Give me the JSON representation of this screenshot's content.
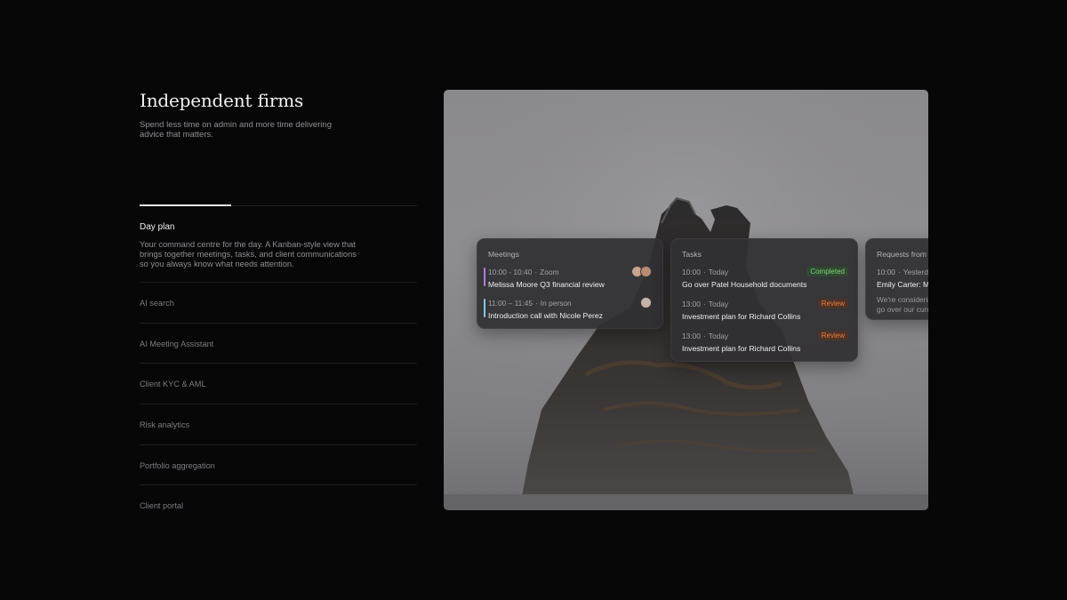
{
  "hero": {
    "headline": "Independent firms",
    "subheadline": "Spend less time on admin and more time delivering advice that matters."
  },
  "features": {
    "progress": 0.33,
    "active": {
      "title": "Day plan",
      "description": "Your command centre for the day. A Kanban-style view that brings together meetings, tasks, and client communications so you always know what needs attention."
    },
    "items": [
      {
        "label": "AI search"
      },
      {
        "label": "AI Meeting Assistant"
      },
      {
        "label": "Client KYC & AML"
      },
      {
        "label": "Risk analytics"
      },
      {
        "label": "Portfolio aggregation"
      },
      {
        "label": "Client portal"
      }
    ]
  },
  "board": {
    "meetings": {
      "title": "Meetings",
      "items": [
        {
          "time": "10:00 - 10:40",
          "sep": "·",
          "where": "Zoom",
          "name": "Melissa Moore Q3 financial review",
          "accent": "#b27be0"
        },
        {
          "time": "11:00 – 11:45",
          "sep": "·",
          "where": "In person",
          "name": "Introduction call with Nicole Perez",
          "accent": "#7fc8e6"
        }
      ]
    },
    "tasks": {
      "title": "Tasks",
      "items": [
        {
          "time": "10:00",
          "sep": "·",
          "when": "Today",
          "name": "Go over Patel Household documents",
          "status": "Completed"
        },
        {
          "time": "13:00",
          "sep": "·",
          "when": "Today",
          "name": "Investment plan for Richard Collins",
          "status": "Review"
        },
        {
          "time": "13:00",
          "sep": "·",
          "when": "Today",
          "name": "Investment plan for Richard Collins",
          "status": "Review"
        }
      ]
    },
    "requests": {
      "title": "Requests from c",
      "items": [
        {
          "time": "10:00",
          "sep": "·",
          "when": "Yesterd",
          "name": "Emily Carter: M",
          "preview_line1": "We're considerin",
          "preview_line2": "go over our curr"
        }
      ]
    }
  }
}
